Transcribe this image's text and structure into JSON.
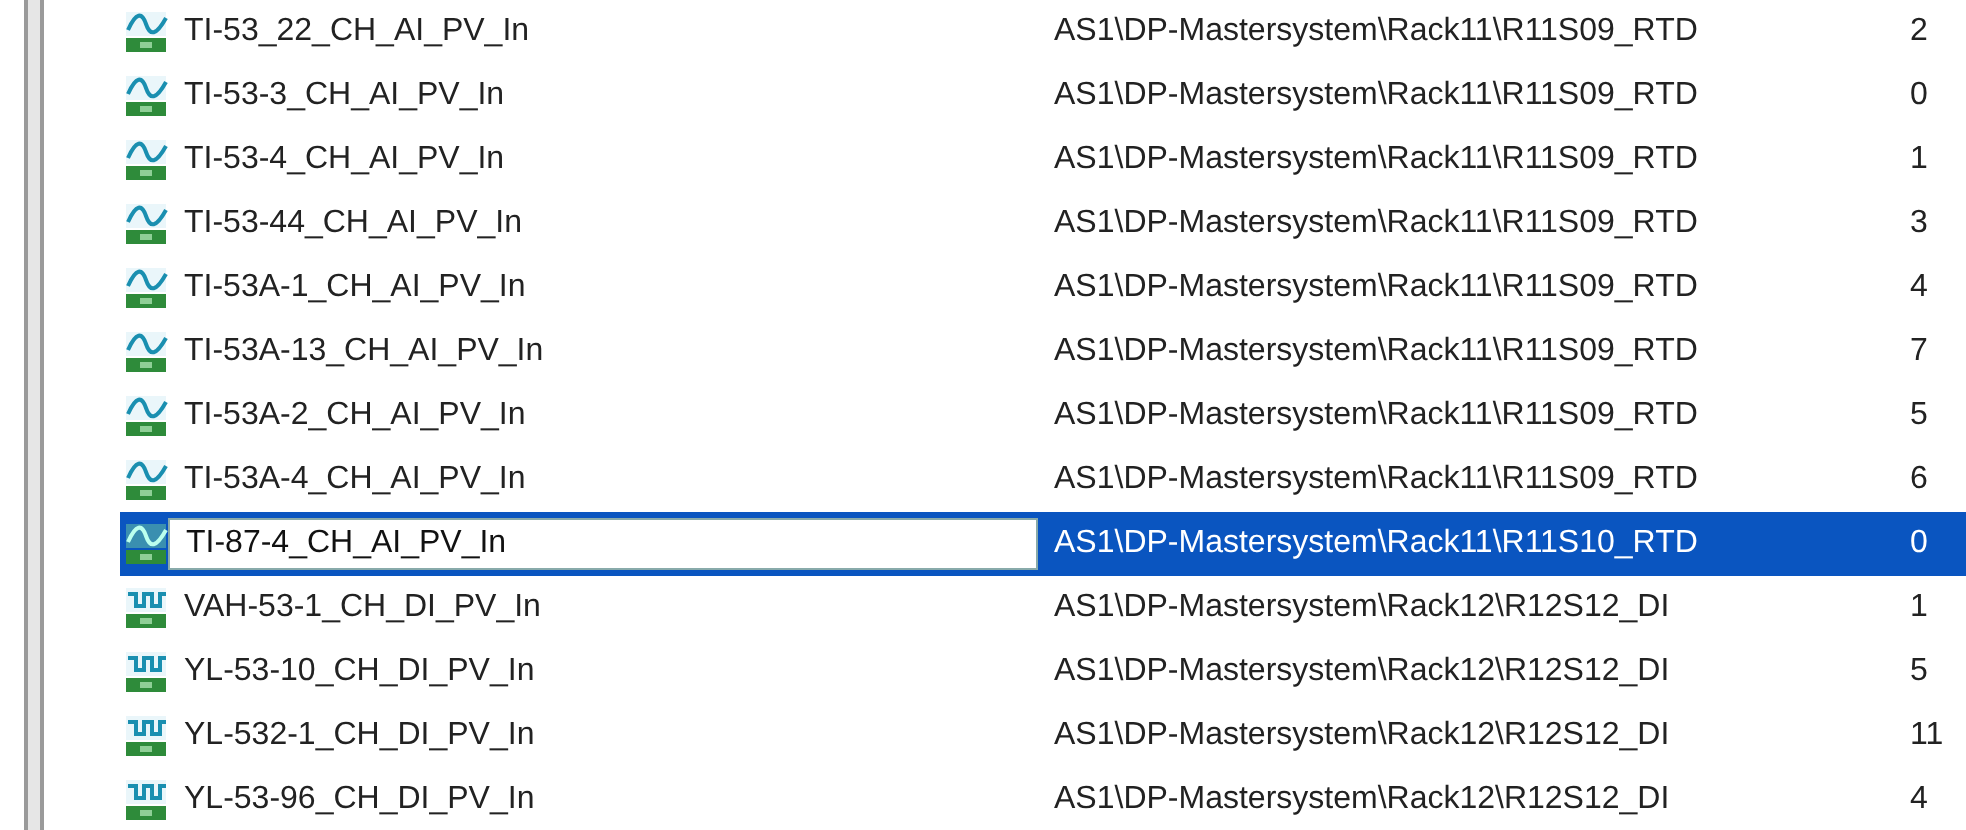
{
  "rows": [
    {
      "kind": "analog",
      "name": "TI-53_22_CH_AI_PV_In",
      "address": "AS1\\DP-Mastersystem\\Rack11\\R11S09_RTD",
      "channel": "2",
      "selected": false
    },
    {
      "kind": "analog",
      "name": "TI-53-3_CH_AI_PV_In",
      "address": "AS1\\DP-Mastersystem\\Rack11\\R11S09_RTD",
      "channel": "0",
      "selected": false
    },
    {
      "kind": "analog",
      "name": "TI-53-4_CH_AI_PV_In",
      "address": "AS1\\DP-Mastersystem\\Rack11\\R11S09_RTD",
      "channel": "1",
      "selected": false
    },
    {
      "kind": "analog",
      "name": "TI-53-44_CH_AI_PV_In",
      "address": "AS1\\DP-Mastersystem\\Rack11\\R11S09_RTD",
      "channel": "3",
      "selected": false
    },
    {
      "kind": "analog",
      "name": "TI-53A-1_CH_AI_PV_In",
      "address": "AS1\\DP-Mastersystem\\Rack11\\R11S09_RTD",
      "channel": "4",
      "selected": false
    },
    {
      "kind": "analog",
      "name": "TI-53A-13_CH_AI_PV_In",
      "address": "AS1\\DP-Mastersystem\\Rack11\\R11S09_RTD",
      "channel": "7",
      "selected": false
    },
    {
      "kind": "analog",
      "name": "TI-53A-2_CH_AI_PV_In",
      "address": "AS1\\DP-Mastersystem\\Rack11\\R11S09_RTD",
      "channel": "5",
      "selected": false
    },
    {
      "kind": "analog",
      "name": "TI-53A-4_CH_AI_PV_In",
      "address": "AS1\\DP-Mastersystem\\Rack11\\R11S09_RTD",
      "channel": "6",
      "selected": false
    },
    {
      "kind": "analog",
      "name": "TI-87-4_CH_AI_PV_In",
      "address": "AS1\\DP-Mastersystem\\Rack11\\R11S10_RTD",
      "channel": "0",
      "selected": true
    },
    {
      "kind": "digital",
      "name": "VAH-53-1_CH_DI_PV_In",
      "address": "AS1\\DP-Mastersystem\\Rack12\\R12S12_DI",
      "channel": "1",
      "selected": false
    },
    {
      "kind": "digital",
      "name": "YL-53-10_CH_DI_PV_In",
      "address": "AS1\\DP-Mastersystem\\Rack12\\R12S12_DI",
      "channel": "5",
      "selected": false
    },
    {
      "kind": "digital",
      "name": "YL-532-1_CH_DI_PV_In",
      "address": "AS1\\DP-Mastersystem\\Rack12\\R12S12_DI",
      "channel": "11",
      "selected": false
    },
    {
      "kind": "digital",
      "name": "YL-53-96_CH_DI_PV_In",
      "address": "AS1\\DP-Mastersystem\\Rack12\\R12S12_DI",
      "channel": "4",
      "selected": false
    }
  ]
}
